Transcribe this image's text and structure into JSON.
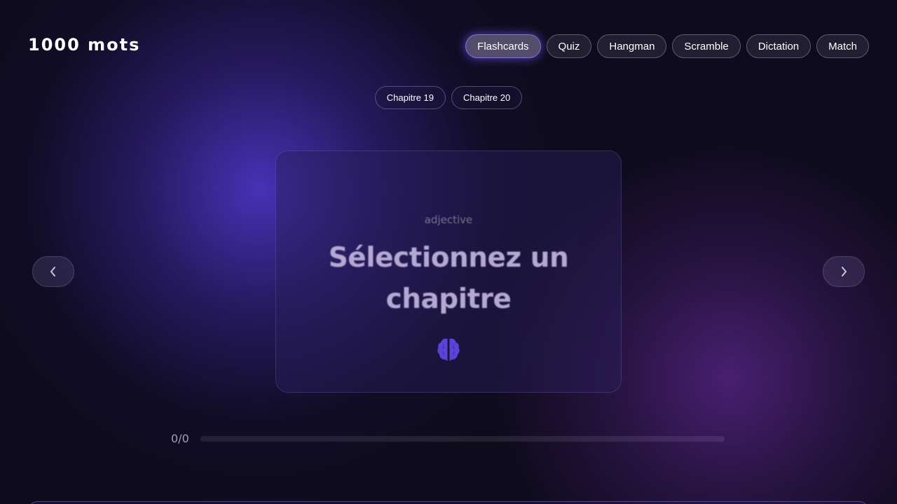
{
  "app": {
    "title": "1000 mots"
  },
  "modes": [
    {
      "label": "Flashcards",
      "active": true
    },
    {
      "label": "Quiz",
      "active": false
    },
    {
      "label": "Hangman",
      "active": false
    },
    {
      "label": "Scramble",
      "active": false
    },
    {
      "label": "Dictation",
      "active": false
    },
    {
      "label": "Match",
      "active": false
    }
  ],
  "chapters": [
    {
      "label": "Chapitre 19"
    },
    {
      "label": "Chapitre 20"
    }
  ],
  "card": {
    "type": "adjective",
    "word": "Sélectionnez un chapitre",
    "icon": "brain-icon"
  },
  "navigation": {
    "prev_icon": "chevron-left-icon",
    "next_icon": "chevron-right-icon"
  },
  "progress": {
    "text": "0/0",
    "fraction": 0
  },
  "colors": {
    "background": "#0e0b1c",
    "accent": "#7d6cff",
    "glow_primary": "#4a34be",
    "glow_secondary": "#5c268c",
    "card_word": "#b4a9d3",
    "brain": "#5a44d8"
  }
}
